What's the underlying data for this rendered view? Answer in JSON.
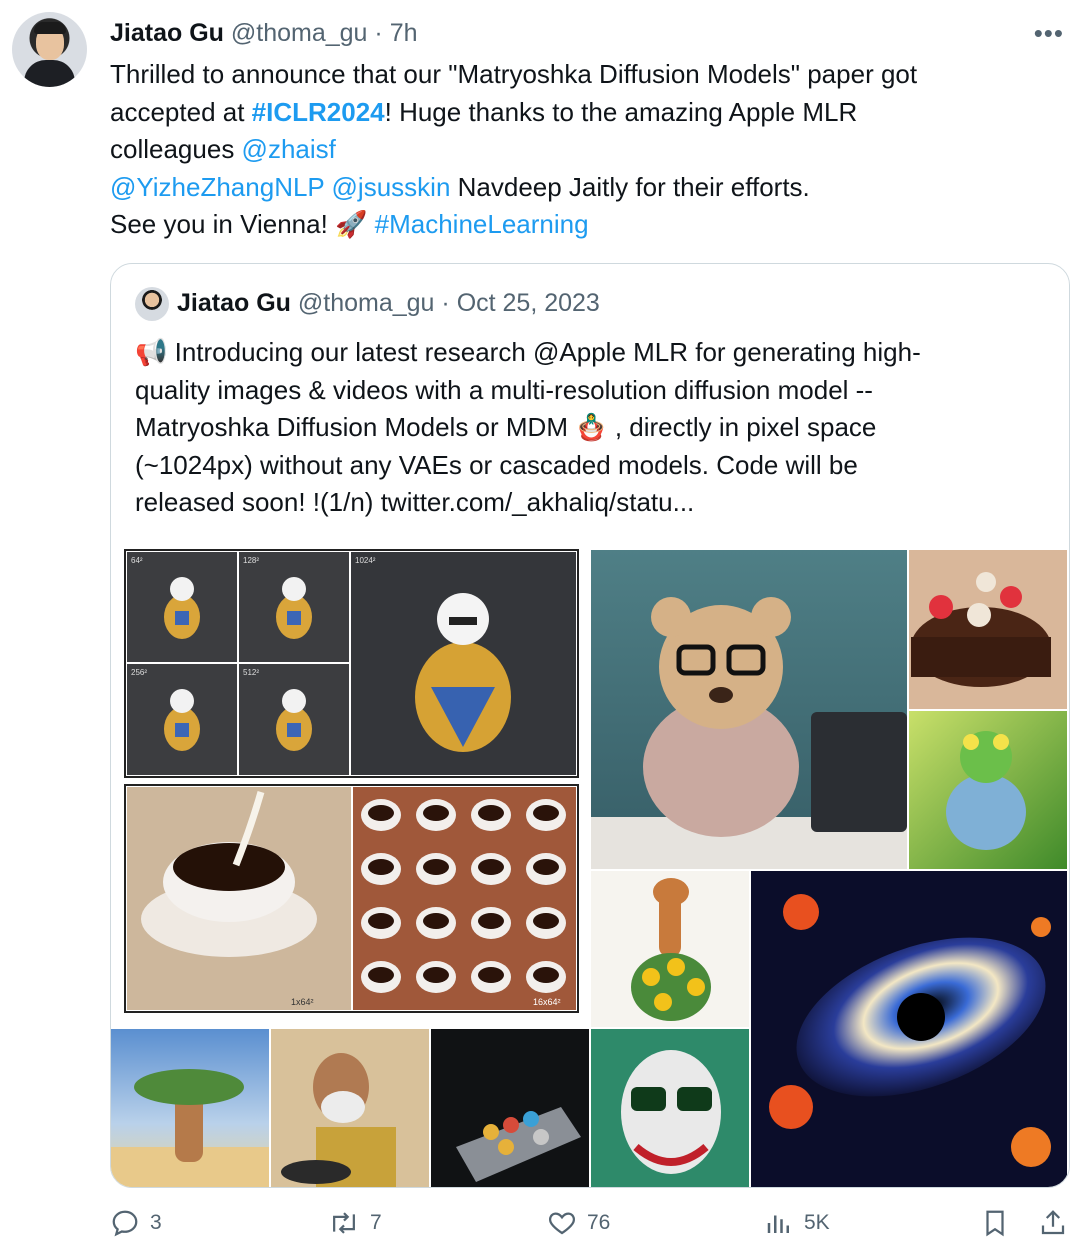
{
  "tweet": {
    "author_name": "Jiatao Gu",
    "author_handle": "@thoma_gu",
    "separator": "·",
    "time": "7h",
    "more_icon": "more-icon",
    "text": {
      "line1": "Thrilled to announce that our \"Matryoshka Diffusion Models\" paper got",
      "line2_pre": "accepted at ",
      "line2_tag": "#ICLR2024",
      "line2_post": "! Huge thanks to the amazing Apple MLR",
      "line3_pre": "colleagues ",
      "line3_mention": "@zhaisf",
      "line4_mention1": "@YizheZhangNLP",
      "line4_mention2": "@jsusskin",
      "line4_post": " Navdeep Jaitly for their efforts.",
      "line5_pre": "See you in Vienna! ",
      "line5_emoji": "🚀",
      "line5_tag": "#MachineLearning"
    }
  },
  "quoted": {
    "author_name": "Jiatao Gu",
    "author_handle": "@thoma_gu",
    "separator": "·",
    "date": "Oct 25, 2023",
    "text": {
      "emoji": "📢",
      "line1": " Introducing our latest research @Apple MLR for generating high-",
      "line2": "quality images & videos with a multi-resolution diffusion model --",
      "line3_pre": "Matryoshka Diffusion Models or MDM ",
      "line3_emoji": "🪆",
      "line3_post": " , directly in pixel space",
      "line4": "(~1024px) without any VAEs or cascaded models. Code will be",
      "line5": "released soon! !(1/n)  twitter.com/_akhaliq/statu..."
    },
    "image_labels": {
      "r64": "64²",
      "r128": "128²",
      "r1024": "1024²",
      "r256": "256²",
      "r512": "512²",
      "coffee_1x": "1x64²",
      "coffee_16x": "16x64²"
    }
  },
  "actions": {
    "reply_count": "3",
    "repost_count": "7",
    "like_count": "76",
    "views_count": "5K"
  },
  "colors": {
    "accent": "#1d9bf0",
    "muted": "#536471",
    "border": "#cfd9de"
  }
}
